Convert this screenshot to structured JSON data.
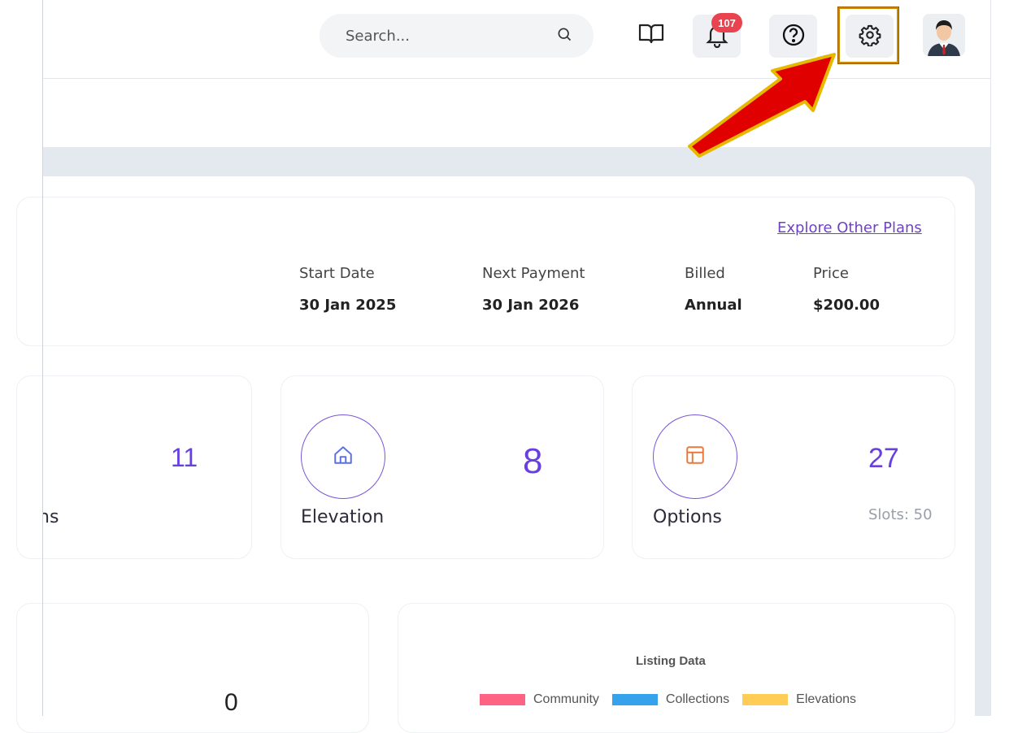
{
  "header": {
    "search": {
      "placeholder": "Search..."
    },
    "notifications": {
      "count": "107"
    }
  },
  "plan": {
    "explore_link": "Explore Other Plans",
    "columns": [
      {
        "label": "Start Date",
        "value": "30 Jan 2025"
      },
      {
        "label": "Next Payment",
        "value": "30 Jan 2026"
      },
      {
        "label": "Billed",
        "value": "Annual"
      },
      {
        "label": "Price",
        "value": "$200.00"
      }
    ]
  },
  "stats": [
    {
      "label": "ns",
      "value": "11"
    },
    {
      "label": "Elevation",
      "value": "8",
      "icon": "home-icon"
    },
    {
      "label": "Options",
      "value": "27",
      "slots": "Slots: 50",
      "icon": "layout-icon"
    }
  ],
  "bottom": {
    "left_value": "0",
    "chart_title": "Listing Data",
    "legend": [
      {
        "label": "Community",
        "color": "#ff6384"
      },
      {
        "label": "Collections",
        "color": "#36a2eb"
      },
      {
        "label": "Elevations",
        "color": "#ffcd56"
      }
    ]
  },
  "colors": {
    "accent": "#6a3fe0",
    "badge": "#e8434f",
    "highlight_border": "#c98a00",
    "arrow": "#e00000"
  }
}
